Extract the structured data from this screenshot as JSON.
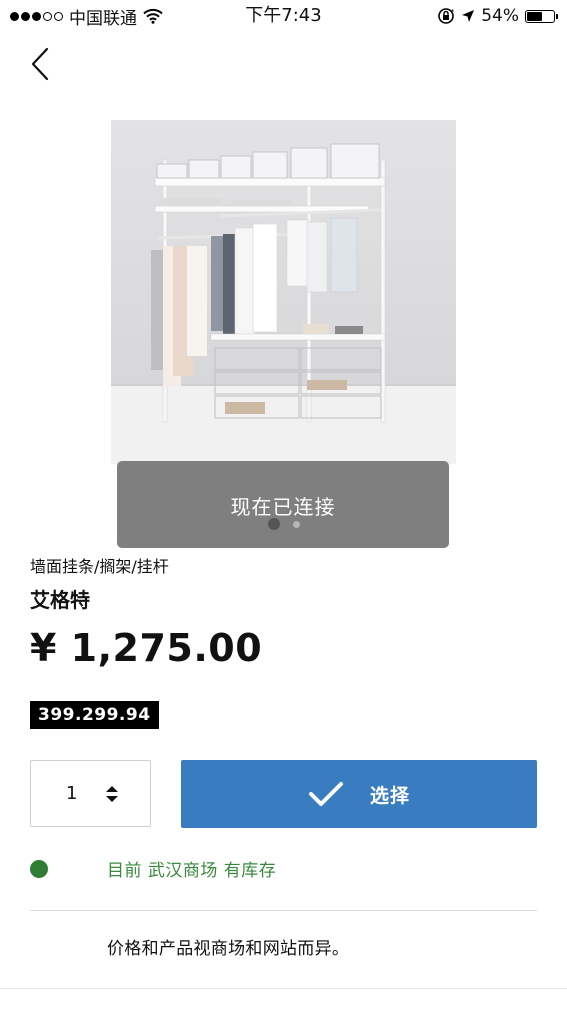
{
  "status_bar": {
    "carrier": "中国联通",
    "time": "下午7:43",
    "battery": "54%",
    "battery_level": 0.54,
    "signal_bars_filled": 3,
    "signal_bars_total": 5
  },
  "product": {
    "category": "墙面挂条/搁架/挂杆",
    "name": "艾格特",
    "price": "¥ 1,275.00",
    "article_number": "399.299.94"
  },
  "toast": {
    "message": "现在已连接"
  },
  "image_pager": {
    "pages": 2,
    "active": 1
  },
  "purchase": {
    "quantity": "1",
    "select_label": "选择"
  },
  "stock": {
    "text": "目前 武汉商场 有库存",
    "color": "#2e7d32"
  },
  "note": "价格和产品视商场和网站而异。",
  "colors": {
    "accent": "#3a7cc0",
    "stock_green": "#2e7d32"
  }
}
